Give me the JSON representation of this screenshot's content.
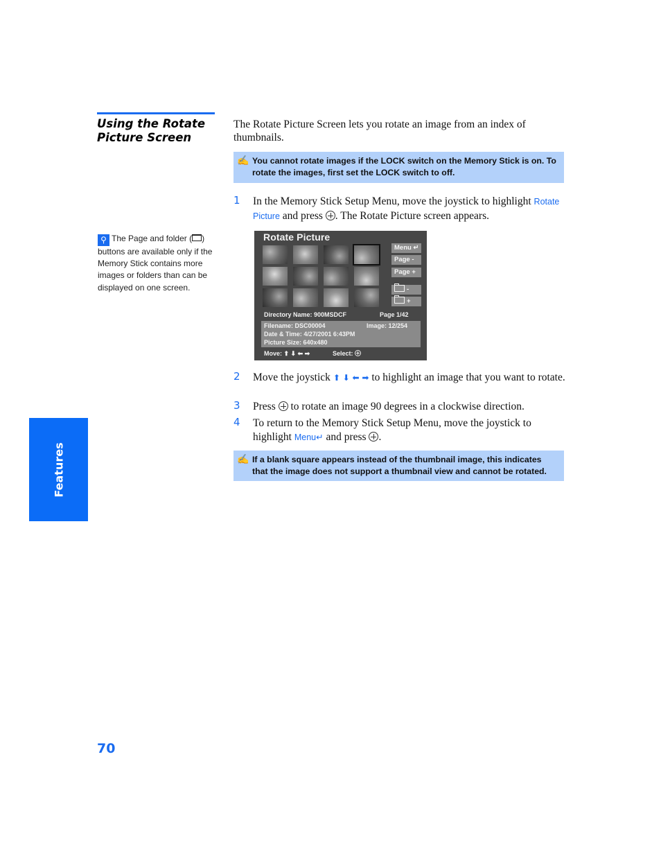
{
  "section": {
    "title": "Using the Rotate Picture Screen"
  },
  "intro": "The Rotate Picture Screen lets you rotate an image from an index of thumbnails.",
  "notes": [
    {
      "icon": "note-pencil-icon",
      "text": "You cannot rotate images if the LOCK switch on the Memory Stick is on. To rotate the images, first set the LOCK switch to off."
    },
    {
      "icon": "note-pencil-icon",
      "text": "If a blank square appears instead of the thumbnail image, this indicates that the image does not support a thumbnail view and cannot be rotated."
    }
  ],
  "steps": [
    {
      "num": "1",
      "pre": "In the Memory Stick Setup Menu, move the joystick to highlight ",
      "term": "Rotate Picture",
      "mid": " and press ",
      "post": ". The Rotate Picture screen appears."
    },
    {
      "num": "2",
      "pre": "Move the joystick ",
      "arrows": "⬆ ⬇ ⬅ ➡",
      "post": " to highlight an image that you want to rotate."
    },
    {
      "num": "3",
      "pre": "Press ",
      "post": " to rotate an image 90 degrees in a clockwise direction."
    },
    {
      "num": "4",
      "pre": "To return to the Memory Stick Setup Menu, move the joystick to highlight ",
      "term": "Menu↵",
      "mid": " and press ",
      "post": "."
    }
  ],
  "tv_screen": {
    "title": "Rotate Picture",
    "thumbnail_count": 12,
    "selected_thumbnail": 4,
    "buttons": [
      "Menu ↵",
      "Page -",
      "Page +",
      "-",
      "+"
    ],
    "directory": "Directory Name: 900MSDCF",
    "page": "Page 1/42",
    "filename": "Filename: DSC00004",
    "image": "Image: 12/254",
    "datetime": "Date & Time: 4/27/2001 6:43PM",
    "size": "Picture Size: 640x480",
    "move": "Move: ⬆ ⬇ ⬅ ➡",
    "select": "Select:"
  },
  "tip": {
    "icon": "hint-lightbulb-icon",
    "pre": "The Page and folder (",
    "post": ") buttons are available only if the Memory Stick contains more images or folders than can be displayed on one screen."
  },
  "side_tab": "Features",
  "page_number": "70",
  "colors": {
    "accent": "#1a6cf0",
    "note_bg": "#b3d1fa",
    "tab_bg": "#0b6cf7",
    "tv_bg": "#474747"
  }
}
